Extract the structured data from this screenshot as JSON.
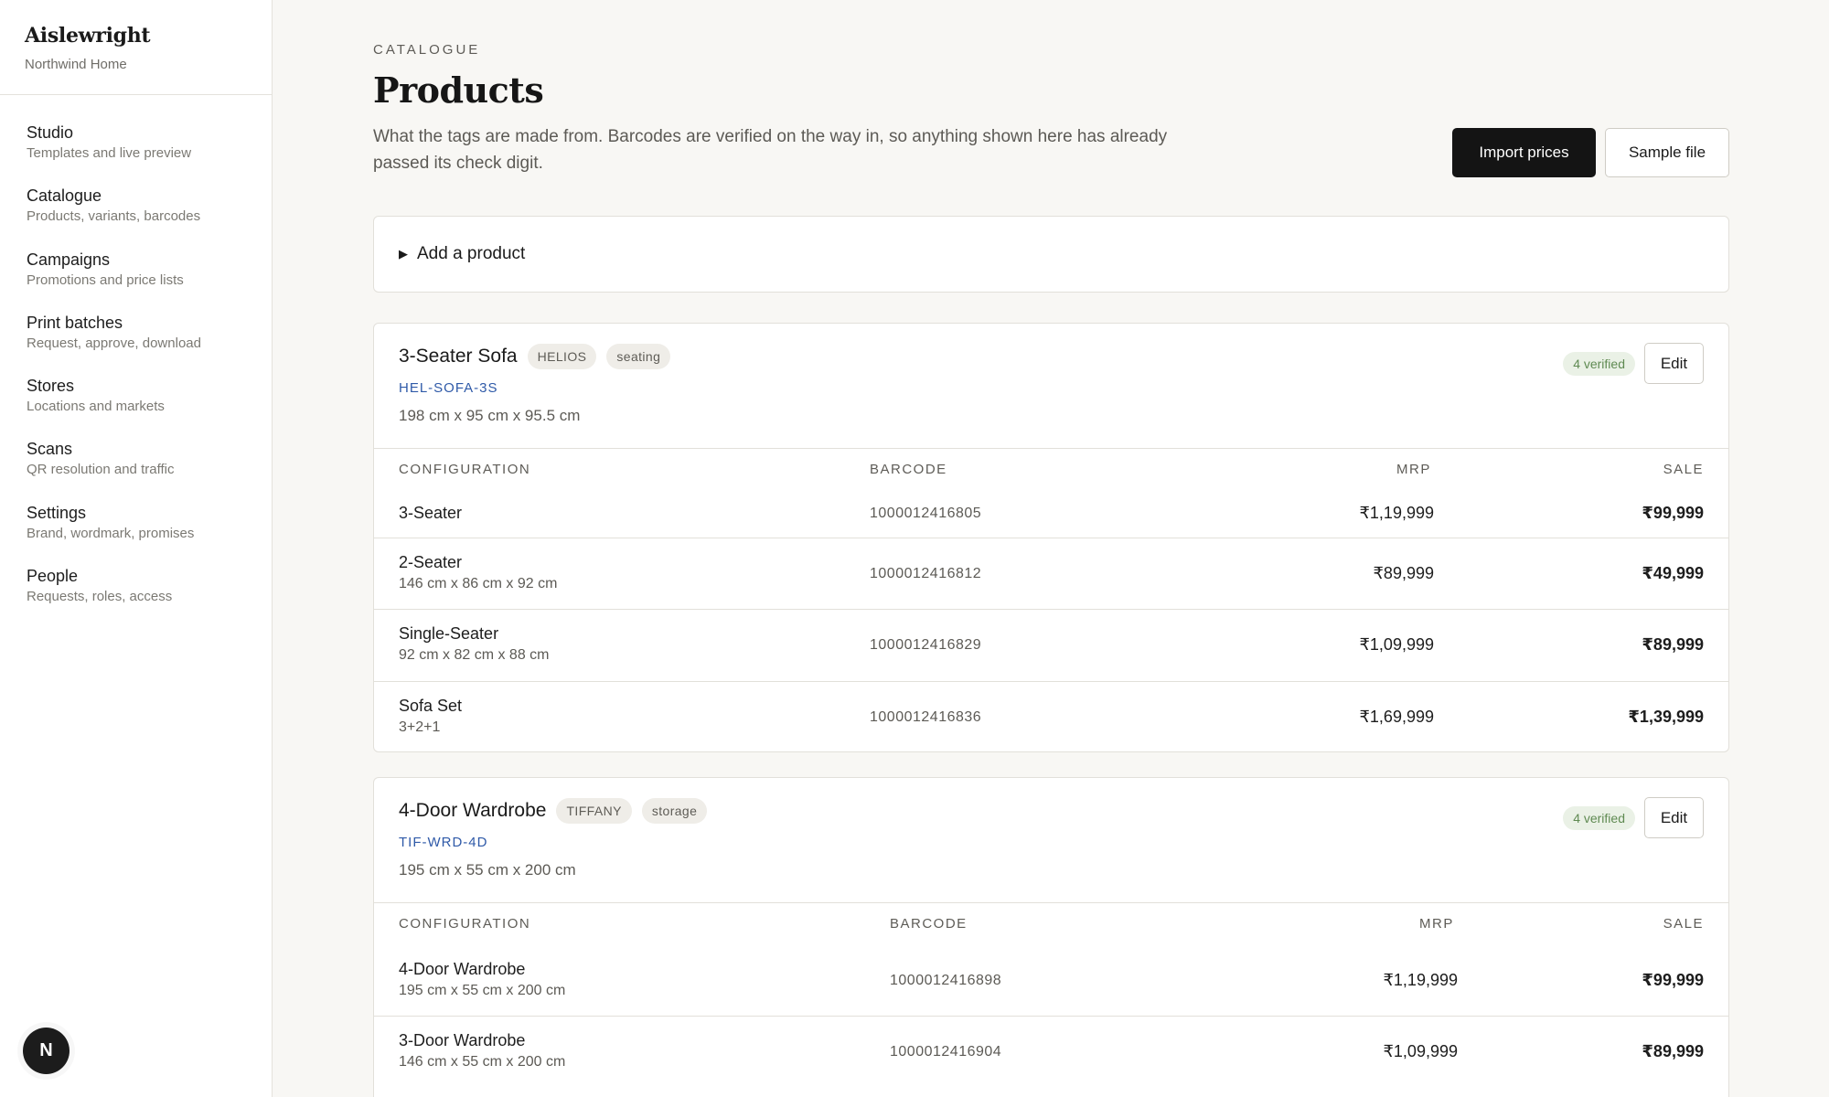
{
  "sidebar": {
    "brand": "Aislewright",
    "org": "Northwind Home",
    "items": [
      {
        "label": "Studio",
        "sub": "Templates and live preview"
      },
      {
        "label": "Catalogue",
        "sub": "Products, variants, barcodes"
      },
      {
        "label": "Campaigns",
        "sub": "Promotions and price lists"
      },
      {
        "label": "Print batches",
        "sub": "Request, approve, download"
      },
      {
        "label": "Stores",
        "sub": "Locations and markets"
      },
      {
        "label": "Scans",
        "sub": "QR resolution and traffic"
      },
      {
        "label": "Settings",
        "sub": "Brand, wordmark, promises"
      },
      {
        "label": "People",
        "sub": "Requests, roles, access"
      }
    ],
    "avatar_initial": "N"
  },
  "header": {
    "eyebrow": "CATALOGUE",
    "title": "Products",
    "description": "What the tags are made from. Barcodes are verified on the way in, so anything shown here has already passed its check digit.",
    "import_label": "Import prices",
    "sample_label": "Sample file"
  },
  "add_product": {
    "label": "Add a product"
  },
  "columns": {
    "configuration": "CONFIGURATION",
    "barcode": "BARCODE",
    "mrp": "MRP",
    "sale": "SALE"
  },
  "products": [
    {
      "name": "3-Seater Sofa",
      "brand_tag": "HELIOS",
      "category_tag": "seating",
      "sku": "HEL-SOFA-3S",
      "dimensions": "198 cm x 95 cm x 95.5 cm",
      "verified": "4 verified",
      "edit_label": "Edit",
      "variants": [
        {
          "name": "3-Seater",
          "sub": "",
          "barcode": "1000012416805",
          "mrp": "₹1,19,999",
          "sale": "₹99,999"
        },
        {
          "name": "2-Seater",
          "sub": "146 cm x 86 cm x 92 cm",
          "barcode": "1000012416812",
          "mrp": "₹89,999",
          "sale": "₹49,999"
        },
        {
          "name": "Single-Seater",
          "sub": "92 cm x 82 cm x 88 cm",
          "barcode": "1000012416829",
          "mrp": "₹1,09,999",
          "sale": "₹89,999"
        },
        {
          "name": "Sofa Set",
          "sub": "3+2+1",
          "barcode": "1000012416836",
          "mrp": "₹1,69,999",
          "sale": "₹1,39,999"
        }
      ]
    },
    {
      "name": "4-Door Wardrobe",
      "brand_tag": "TIFFANY",
      "category_tag": "storage",
      "sku": "TIF-WRD-4D",
      "dimensions": "195 cm x 55 cm x 200 cm",
      "verified": "4 verified",
      "edit_label": "Edit",
      "variants": [
        {
          "name": "4-Door Wardrobe",
          "sub": "195 cm x 55 cm x 200 cm",
          "barcode": "1000012416898",
          "mrp": "₹1,19,999",
          "sale": "₹99,999"
        },
        {
          "name": "3-Door Wardrobe",
          "sub": "146 cm x 55 cm x 200 cm",
          "barcode": "1000012416904",
          "mrp": "₹1,09,999",
          "sale": "₹89,999"
        }
      ]
    }
  ]
}
